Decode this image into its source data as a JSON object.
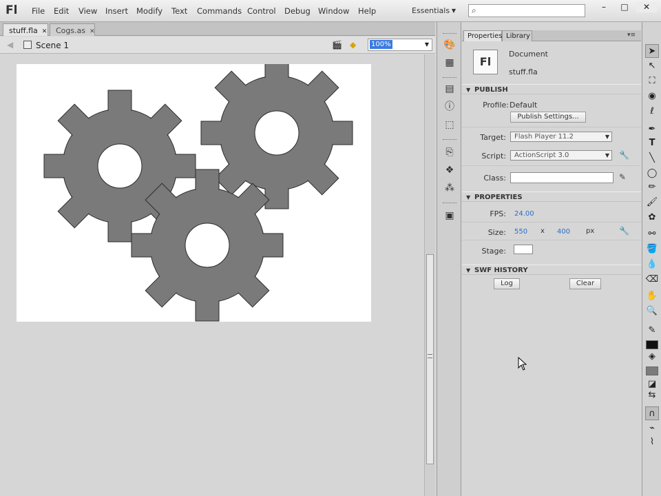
{
  "app": {
    "logo": "Fl",
    "menu": [
      "File",
      "Edit",
      "View",
      "Insert",
      "Modify",
      "Text",
      "Commands",
      "Control",
      "Debug",
      "Window",
      "Help"
    ],
    "workspace": "Essentials",
    "search_placeholder": "",
    "window_controls": [
      "–",
      "□",
      "✕"
    ]
  },
  "document": {
    "tabs": [
      {
        "label": "stuff.fla",
        "active": true
      },
      {
        "label": "Cogs.as",
        "active": false
      }
    ],
    "scene_label": "Scene 1",
    "zoom": "100%"
  },
  "properties_panel": {
    "tabs": [
      "Properties",
      "Library"
    ],
    "doc_icon_text": "Fl",
    "doc_type": "Document",
    "doc_name": "stuff.fla",
    "publish": {
      "header": "PUBLISH",
      "profile_label": "Profile:",
      "profile_value": "Default",
      "publish_settings_button": "Publish Settings...",
      "target_label": "Target:",
      "target_value": "Flash Player 11.2",
      "script_label": "Script:",
      "script_value": "ActionScript 3.0",
      "class_label": "Class:",
      "class_value": ""
    },
    "properties": {
      "header": "PROPERTIES",
      "fps_label": "FPS:",
      "fps_value": "24.00",
      "size_label": "Size:",
      "width": "550",
      "x_sep": "x",
      "height": "400",
      "unit": "px",
      "stage_label": "Stage:",
      "stage_color": "#ffffff"
    },
    "swf_history": {
      "header": "SWF HISTORY",
      "log_button": "Log",
      "clear_button": "Clear"
    }
  },
  "stage": {
    "background": "#ffffff",
    "cog_color": "#7a7a7a",
    "pasteboard_color": "#d6d6d6"
  },
  "icons": {
    "tools": [
      "selection-tool-icon",
      "subselection-tool-icon",
      "free-transform-tool-icon",
      "3d-rotation-tool-icon",
      "lasso-tool-icon",
      "pen-tool-icon",
      "text-tool-icon",
      "line-tool-icon",
      "oval-tool-icon",
      "pencil-tool-icon",
      "brush-tool-icon",
      "deco-tool-icon",
      "bone-tool-icon",
      "paint-bucket-tool-icon",
      "eyedropper-tool-icon",
      "eraser-tool-icon",
      "hand-tool-icon",
      "zoom-tool-icon"
    ]
  }
}
